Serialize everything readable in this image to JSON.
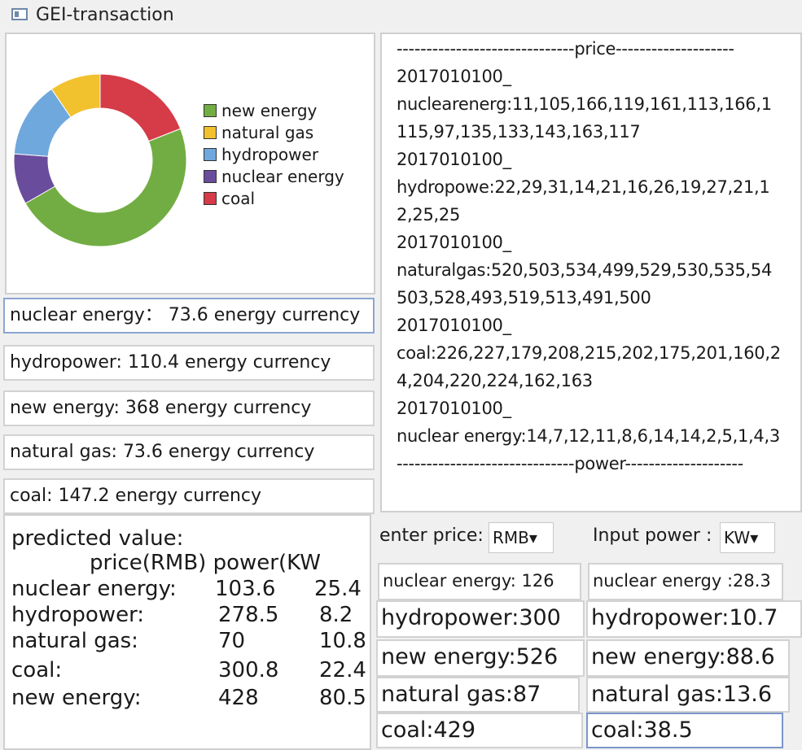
{
  "window": {
    "title": "GEI-transaction"
  },
  "chart_data": {
    "type": "pie",
    "categories": [
      "new energy",
      "natural gas",
      "hydropower",
      "nuclear energy",
      "coal"
    ],
    "values": [
      368,
      73.6,
      110.4,
      73.6,
      147.2
    ],
    "legend": [
      "new energy",
      "natural gas",
      "hydropower",
      "nuclear energy",
      "coal"
    ],
    "colors": [
      "#72ad43",
      "#f2c12e",
      "#6fa8dc",
      "#6a4c9c",
      "#d63b48"
    ],
    "legend_position": "right"
  },
  "energy_values": [
    "nuclear energy： 73.6 energy currency",
    "hydropower:  110.4 energy currency",
    "new energy:   368 energy currency",
    "natural gas:  73.6 energy currency",
    "coal:  147.2 energy currency"
  ],
  "price_panel": {
    "lines": [
      "------------------------------price--------------------",
      "2017010100_",
      "nuclearenerg:11,105,166,119,161,113,166,1",
      "115,97,135,133,143,163,117",
      "2017010100_",
      "hydropowe:22,29,31,14,21,16,26,19,27,21,1",
      "2,25,25",
      "2017010100_",
      "naturalgas:520,503,534,499,529,530,535,54",
      "503,528,493,519,513,491,500",
      "2017010100_",
      "coal:226,227,179,208,215,202,175,201,160,2",
      "4,204,220,224,162,163",
      "2017010100_",
      "nuclear energy:14,7,12,11,8,6,14,14,2,5,1,4,3",
      "------------------------------power--------------------"
    ]
  },
  "predicted": {
    "title": "predicted value:",
    "header": "price(RMB) power(KW",
    "rows": [
      {
        "name": "nuclear energy:",
        "price": "103.6",
        "power": "25.4"
      },
      {
        "name": "hydropower:",
        "price": "278.5",
        "power": "8.2"
      },
      {
        "name": "natural gas:",
        "price": "70",
        "power": "10.8"
      },
      {
        "name": "coal:",
        "price": "300.8",
        "power": "22.4"
      },
      {
        "name": "new energy:",
        "price": "428",
        "power": "80.5"
      }
    ]
  },
  "enter_price": {
    "label": "enter price:",
    "unit": "RMB",
    "arrow": "▾"
  },
  "input_power": {
    "label": "Input power :",
    "unit": "KW",
    "arrow": "▾"
  },
  "price_fields": [
    "nuclear energy:  126",
    "hydropower:300",
    "new energy:526",
    "natural gas:87",
    "coal:429"
  ],
  "power_fields": [
    "nuclear energy :28.3",
    "hydropower:10.7",
    "new energy:88.6",
    "natural gas:13.6",
    "coal:38.5"
  ]
}
